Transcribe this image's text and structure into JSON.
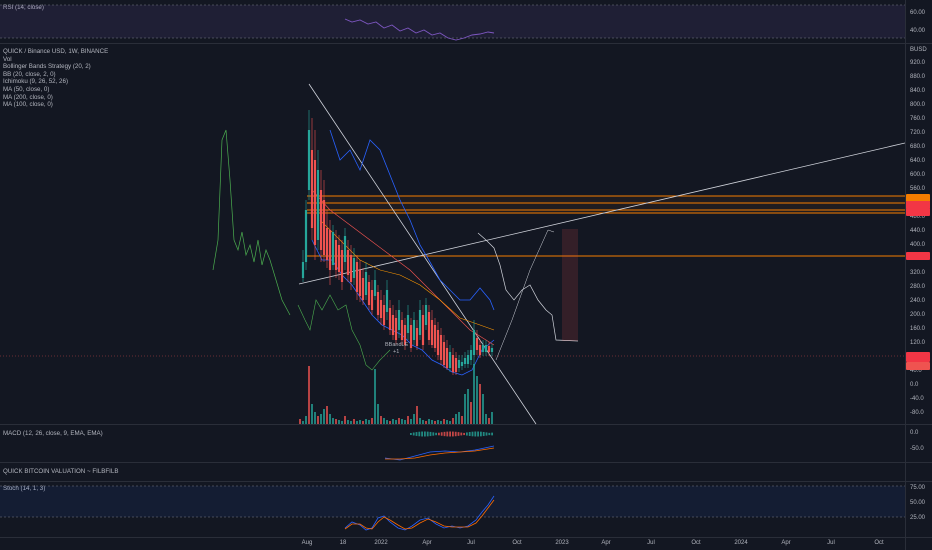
{
  "rsi_pane": {
    "title": "RSI (14, close)",
    "ticks": [
      "60.00",
      "40.00"
    ]
  },
  "main_pane": {
    "symbol_title": "QUICK / Binance USD, 1W, BINANCE",
    "indicators": [
      "Vol",
      "Bollinger Bands Strategy (20, 2)",
      "BB (20, close, 2, 0)",
      "Ichimoku (9, 26, 52, 26)",
      "MA (50, close, 0)",
      "MA (200, close, 0)",
      "MA (100, close, 0)"
    ],
    "currency": "BUSD",
    "ticks": [
      "920.0",
      "880.0",
      "840.0",
      "800.0",
      "760.0",
      "720.0",
      "680.0",
      "640.0",
      "600.0",
      "560.0",
      "520.0",
      "480.0",
      "440.0",
      "400.0",
      "360.0",
      "320.0",
      "280.0",
      "240.0",
      "200.0",
      "160.0",
      "120.0",
      "80.0",
      "40.0",
      "0.0",
      "-40.0",
      "-80.0"
    ],
    "strategy_label": "BBandLE",
    "strategy_qty": "+1"
  },
  "macd_pane": {
    "title": "MACD (12, 26, close, 9, EMA, EMA)",
    "ticks": [
      "0.0",
      "-50.0"
    ]
  },
  "valuation_pane": {
    "title": "QUICK BITCOIN VALUATION ~ FILBFILB"
  },
  "stoch_pane": {
    "title": "Stoch (14, 1, 3)",
    "ticks": [
      "75.00",
      "50.00",
      "25.00"
    ]
  },
  "time_axis": [
    "Aug",
    "18",
    "2022",
    "Apr",
    "Jul",
    "Oct",
    "2023",
    "Apr",
    "Jul",
    "Oct",
    "2024",
    "Apr",
    "Jul",
    "Oct"
  ],
  "colors": {
    "background": "#131722",
    "up": "#26a69a",
    "down": "#ef5350",
    "orange_level": "#f57c00",
    "rsi_band": "#7e57c2",
    "bollinger": "#2962ff",
    "trendline": "#d1d4dc"
  }
}
